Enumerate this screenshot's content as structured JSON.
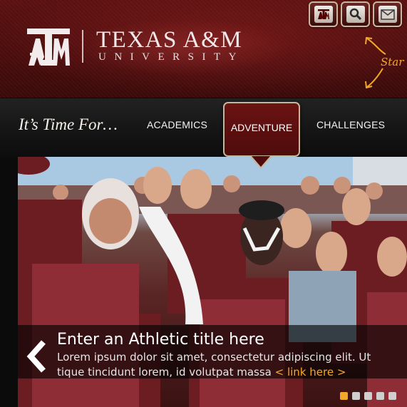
{
  "header": {
    "logo_text": "ATM",
    "title": "TEXAS A&M",
    "subtitle": "UNIVERSITY",
    "start_text": "Star",
    "utility_buttons": [
      {
        "name": "aggie-logo-button",
        "icon": "atm-logo-icon"
      },
      {
        "name": "search-button",
        "icon": "magnifier-icon"
      },
      {
        "name": "mail-button",
        "icon": "envelope-icon"
      }
    ]
  },
  "nav": {
    "tagline": "It’s Time For…",
    "items": [
      {
        "label": "ACADEMICS",
        "active": false
      },
      {
        "label": "ADVENTURE",
        "active": true
      },
      {
        "label": "CHALLENGES",
        "active": false
      }
    ]
  },
  "hero": {
    "title": "Enter an Athletic title here",
    "body_line1": "Lorem ipsum dolor sit amet, consectetur adipiscing elit. Ut",
    "body_line2": "tique tincidunt lorem, id volutpat massa ",
    "link_text": "< link here >",
    "prev_icon": "chevron-left-icon",
    "slides_total": 5,
    "slide_active": 1
  },
  "colors": {
    "maroon": "#500000",
    "accent_orange": "#f2a92a",
    "gold_border": "#c7b79a"
  }
}
